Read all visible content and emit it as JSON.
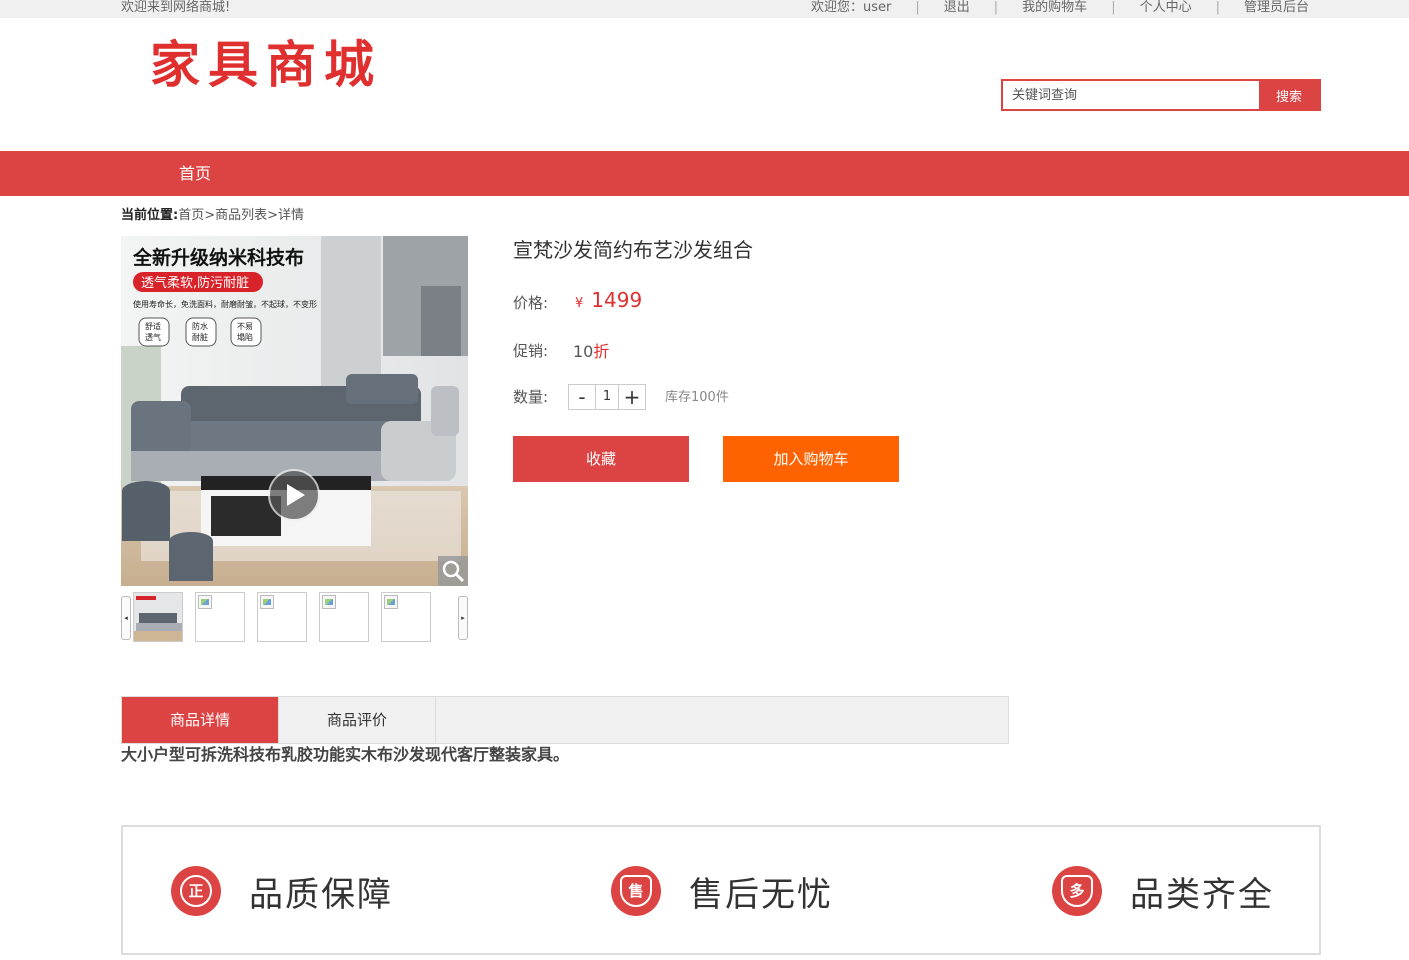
{
  "topbar": {
    "welcome": "欢迎来到网络商城!",
    "user_greeting": "欢迎您：user",
    "logout": "退出",
    "cart": "我的购物车",
    "profile": "个人中心",
    "admin": "管理员后台"
  },
  "header": {
    "logo": "家具商城",
    "search_placeholder": "关键词查询",
    "search_button": "搜索"
  },
  "nav": {
    "home": "首页"
  },
  "breadcrumb": {
    "label": "当前位置:",
    "items": [
      "首页",
      ">",
      "商品列表",
      ">",
      "详情"
    ]
  },
  "gallery": {
    "banner_title": "全新升级纳米科技布",
    "banner_badge": "透气柔软,防污耐脏",
    "banner_sub": "使用寿命长，免洗面料，耐磨耐皱，不起球，不变形",
    "features": [
      "舒适\n透气",
      "防水\n耐脏",
      "不易\n塌陷"
    ],
    "prev_arrow": "◂",
    "next_arrow": "▸",
    "play_icon": "play-icon",
    "zoom_icon": "magnifier-icon"
  },
  "product": {
    "title": "宣梵沙发简约布艺沙发组合",
    "price_label": "价格:",
    "currency": "¥",
    "price": "1499",
    "promo_label": "促销:",
    "promo_value": "10",
    "promo_unit": "折",
    "qty_label": "数量:",
    "qty_minus": "-",
    "qty_value": "1",
    "qty_plus": "+",
    "stock": "库存100件",
    "fav_button": "收藏",
    "cart_button": "加入购物车"
  },
  "tabs": [
    {
      "label": "商品详情",
      "active": true
    },
    {
      "label": "商品评价",
      "active": false
    }
  ],
  "description": "大小户型可拆洗科技布乳胶功能实木布沙发现代客厅整装家具。",
  "guarantees": [
    {
      "icon_char": "正",
      "label": "品质保障"
    },
    {
      "icon_char": "售",
      "label": "售后无忧"
    },
    {
      "icon_char": "多",
      "label": "品类齐全"
    }
  ],
  "colors": {
    "brand_red": "#dc4444",
    "cart_orange": "#ff6200",
    "price_red": "#e02f2f"
  }
}
